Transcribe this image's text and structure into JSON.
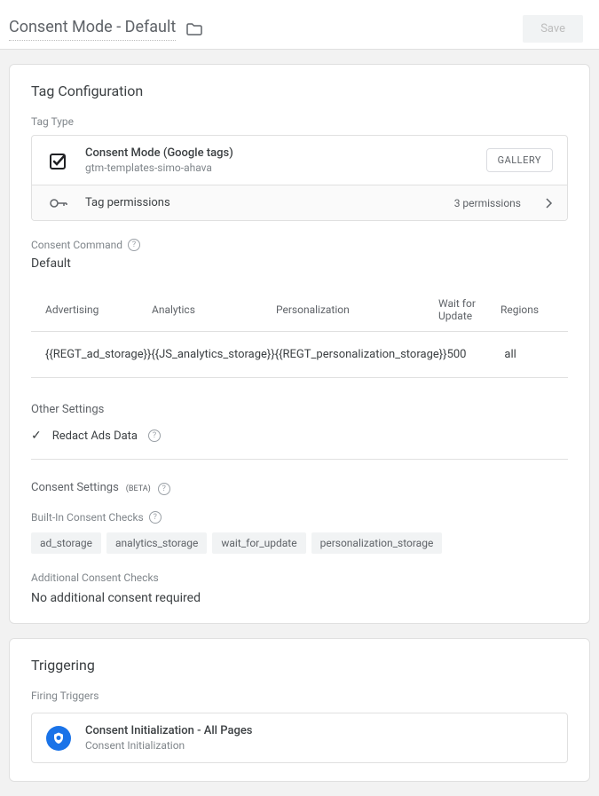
{
  "header": {
    "title": "Consent Mode - Default",
    "save_label": "Save"
  },
  "tag_config": {
    "title": "Tag Configuration",
    "type_label": "Tag Type",
    "name": "Consent Mode (Google tags)",
    "subtitle": "gtm-templates-simo-ahava",
    "gallery_label": "GALLERY",
    "permissions_label": "Tag permissions",
    "permissions_count": "3 permissions"
  },
  "consent_command": {
    "label": "Consent Command",
    "value": "Default"
  },
  "settings_table": {
    "headers": {
      "advertising": "Advertising",
      "analytics": "Analytics",
      "personalization": "Personalization",
      "wait": "Wait for Update",
      "regions": "Regions"
    },
    "row": {
      "advertising": "{{REGT_ad_storage}}",
      "analytics": "{{JS_analytics_storage}}",
      "personalization": "{{REGT_personalization_storage}}",
      "wait": "500",
      "regions": "all"
    }
  },
  "other_settings": {
    "label": "Other Settings",
    "redact": "Redact Ads Data"
  },
  "consent_settings": {
    "label": "Consent Settings",
    "beta": "(BETA)",
    "builtin_label": "Built-In Consent Checks",
    "chips": [
      "ad_storage",
      "analytics_storage",
      "wait_for_update",
      "personalization_storage"
    ],
    "additional_label": "Additional Consent Checks",
    "additional_value": "No additional consent required"
  },
  "triggering": {
    "title": "Triggering",
    "firing_label": "Firing Triggers",
    "trigger_name": "Consent Initialization - All Pages",
    "trigger_type": "Consent Initialization"
  }
}
